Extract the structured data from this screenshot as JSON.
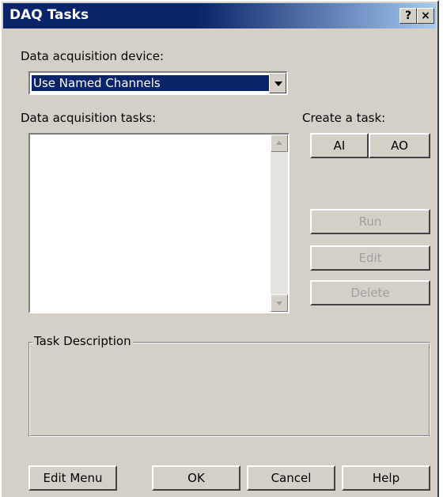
{
  "window": {
    "title": "DAQ Tasks",
    "help_glyph": "?",
    "close_glyph": "×"
  },
  "device": {
    "label": "Data acquisition device:",
    "selected": "Use Named Channels"
  },
  "tasks": {
    "label": "Data acquisition tasks:",
    "items": []
  },
  "create": {
    "label": "Create a task:",
    "ai": "AI",
    "ao": "AO"
  },
  "actions": {
    "run": "Run",
    "edit": "Edit",
    "delete": "Delete"
  },
  "description": {
    "title": "Task Description"
  },
  "footer": {
    "edit_menu": "Edit Menu",
    "ok": "OK",
    "cancel": "Cancel",
    "help": "Help"
  }
}
